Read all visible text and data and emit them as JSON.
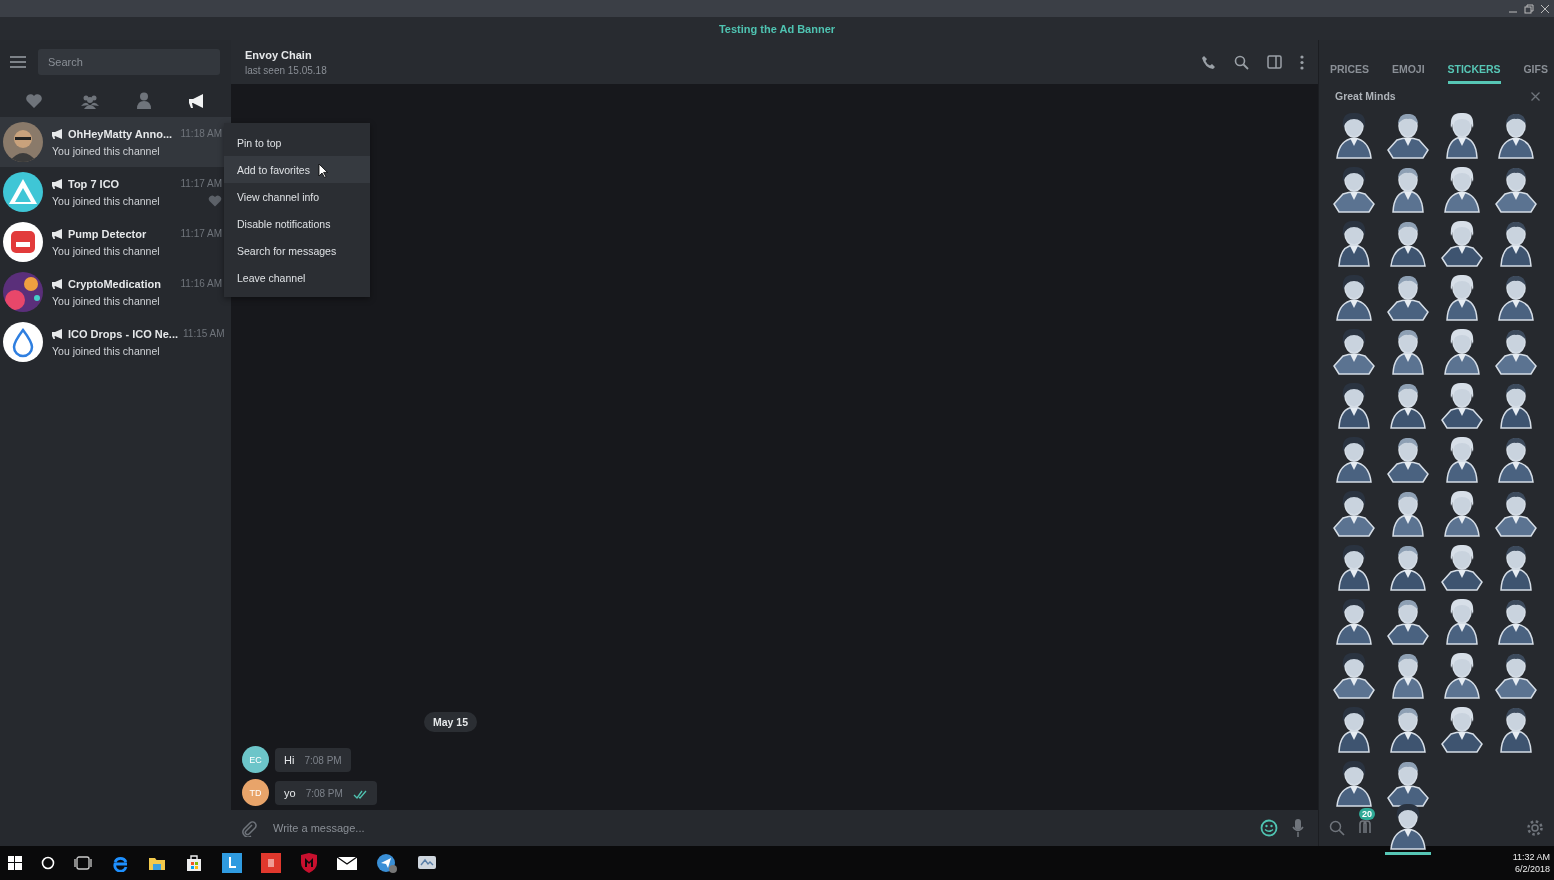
{
  "banner": {
    "title": "Testing the Ad Banner"
  },
  "sidebar": {
    "search": {
      "placeholder": "Search"
    },
    "filters": [
      {
        "kind": "favorites",
        "selected": false
      },
      {
        "kind": "groups",
        "selected": false
      },
      {
        "kind": "people",
        "selected": false
      },
      {
        "kind": "channels",
        "selected": true
      }
    ],
    "chats": [
      {
        "name": "OhHeyMatty Anno...",
        "time": "11:18 AM",
        "preview": "You joined this channel",
        "selected": true,
        "heart": false,
        "kind": "photo",
        "color": "#c9a27c"
      },
      {
        "name": "Top 7 ICO",
        "time": "11:17 AM",
        "preview": "You joined this channel",
        "selected": false,
        "heart": true,
        "kind": "triangle",
        "color": "#3fc6d6"
      },
      {
        "name": "Pump Detector",
        "time": "11:17 AM",
        "preview": "You joined this channel",
        "selected": false,
        "heart": false,
        "kind": "blob",
        "color": "#e23b3b"
      },
      {
        "name": "CryptoMedication",
        "time": "11:16 AM",
        "preview": "You joined this channel",
        "selected": false,
        "heart": false,
        "kind": "swirl",
        "color": "#5a2f7a"
      },
      {
        "name": "ICO Drops - ICO Ne...",
        "time": "11:15 AM",
        "preview": "You joined this channel",
        "selected": false,
        "heart": false,
        "kind": "drop",
        "color": "#ffffff"
      }
    ]
  },
  "context_menu": [
    {
      "label": "Pin to top",
      "selected": false
    },
    {
      "label": "Add to favorites",
      "selected": true
    },
    {
      "label": "View channel info",
      "selected": false
    },
    {
      "label": "Disable notifications",
      "selected": false
    },
    {
      "label": "Search for messages",
      "selected": false
    },
    {
      "label": "Leave channel",
      "selected": false
    }
  ],
  "chat": {
    "name": "Envoy Chain",
    "status": "last seen 15.05.18",
    "date": "May 15",
    "messages": [
      {
        "initials": "EC",
        "color": "#6cc5c9",
        "text": "Hi",
        "time": "7:08 PM",
        "read": false
      },
      {
        "initials": "TD",
        "color": "#e8a46a",
        "text": "yo",
        "time": "7:08 PM",
        "read": true
      }
    ],
    "compose": {
      "placeholder": "Write a message..."
    }
  },
  "panel": {
    "tabs": [
      {
        "label": "PRICES",
        "selected": false
      },
      {
        "label": "EMOJI",
        "selected": false
      },
      {
        "label": "STICKERS",
        "selected": true
      },
      {
        "label": "GIFS",
        "selected": false
      }
    ],
    "set_title": "Great Minds",
    "badge": "20"
  },
  "taskbar": {
    "time": "11:32 AM",
    "date": "6/2/2018"
  }
}
